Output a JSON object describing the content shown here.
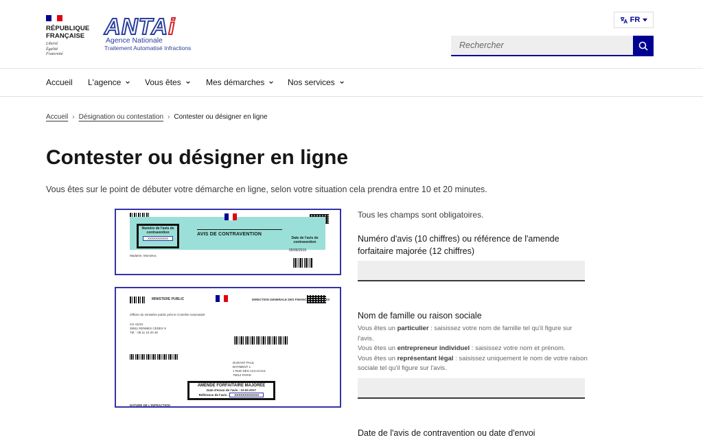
{
  "header": {
    "republic": {
      "line1": "RÉPUBLIQUE",
      "line2": "FRANÇAISE",
      "motto1": "Liberté",
      "motto2": "Égalité",
      "motto3": "Fraternité"
    },
    "brand": {
      "logo_word_a": "ANTA",
      "logo_word_b": "i",
      "sub1": "Agence   Nationale",
      "sub2": "Traitement Automatisé Infractions"
    },
    "lang": {
      "label": "FR"
    },
    "search": {
      "placeholder": "Rechercher"
    }
  },
  "nav": {
    "items": [
      {
        "label": "Accueil"
      },
      {
        "label": "L'agence"
      },
      {
        "label": "Vous êtes"
      },
      {
        "label": "Mes démarches"
      },
      {
        "label": "Nos services"
      }
    ]
  },
  "breadcrumb": {
    "items": [
      "Accueil",
      "Désignation ou contestation",
      "Contester ou désigner en ligne"
    ]
  },
  "page": {
    "title": "Contester ou désigner en ligne",
    "intro": "Vous êtes sur le point de débuter votre démarche en ligne, selon votre situation cela prendra entre 10 et 20 minutes."
  },
  "doc1": {
    "box_title": "Numéro de l'avis de contravention",
    "box_value": "XXXXXXXXXX",
    "title": "AVIS DE CONTRAVENTION",
    "date_title": "Date de l'avis de contravention",
    "date_value": "05/06/2019",
    "salutation": "Madame, Monsieur,"
  },
  "doc2": {
    "header": "MINISTERE PUBLIC",
    "dgfip": "DIRECTION GENERALE DES FINANCES PUBLIQUES",
    "officer": "Officier du ministère public près le Contrôle Automatisé",
    "cs": "CS 41101",
    "city": "35911 RENNES CEDEX 9",
    "tel": "Tél. : 08 11 10 20 30",
    "addressee1": "DURANT PAUL",
    "addressee2": "BATIMENT 1",
    "addressee3": "1 RUE DES ACCACIAS",
    "addressee4": "75012 PARIS",
    "amende_title": "AMENDE FORFAITAIRE MAJORÉE",
    "amende_date": "Date d'envoi de l'avis : 10.02.2017",
    "amende_ref": "Référence de l'avis :",
    "amende_value": "XXXXXXXXXXXX",
    "nature": "NATURE DE L'INFRACTION"
  },
  "form": {
    "required_note": "Tous les champs sont obligatoires.",
    "field1_label": "Numéro d'avis (10 chiffres) ou référence de l'amende forfaitaire majorée (12 chiffres)",
    "field2_label": "Nom de famille ou raison sociale",
    "hint_a_pre": "Vous êtes un ",
    "hint_a_bold": "particulier",
    "hint_a_post": " : saisissez votre nom de famille tel qu'il figure sur l'avis.",
    "hint_b_pre": "Vous êtes un ",
    "hint_b_bold": "entrepreneur individuel",
    "hint_b_post": " : saisissez votre nom et prénom.",
    "hint_c_pre": "Vous êtes un ",
    "hint_c_bold": "représentant légal",
    "hint_c_post": " : saisissez uniquement le nom de votre raison sociale tel qu'il figure sur l'avis.",
    "field3_label": "Date de l'avis de contravention ou date d'envoi"
  },
  "colors": {
    "primary": "#000091",
    "flag_blue": "#000091",
    "flag_red": "#e1000f",
    "antai_blue": "#2a3f9c",
    "antai_red": "#d3222a"
  }
}
